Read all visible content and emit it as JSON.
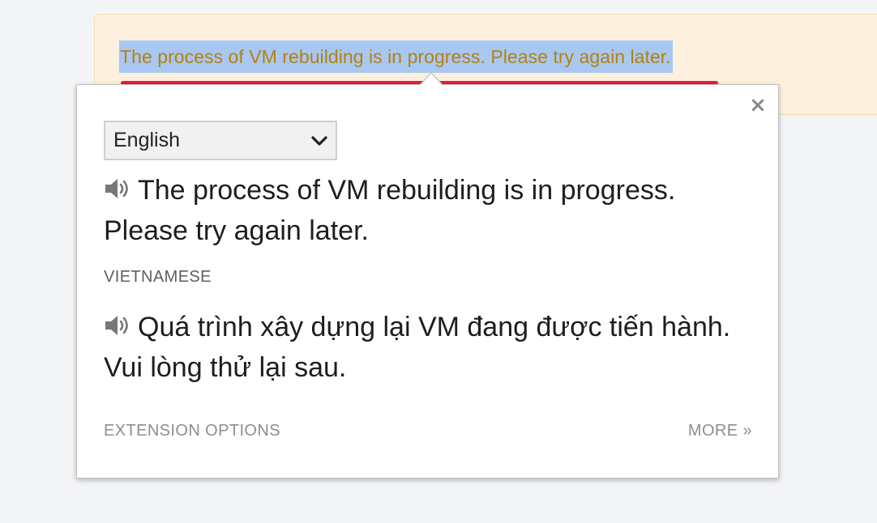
{
  "alert": {
    "message": "The process of VM rebuilding is in progress. Please try again later."
  },
  "popup": {
    "close_glyph": "×",
    "language_select": {
      "selected": "English"
    },
    "source": {
      "text": "The process of VM rebuilding is in progress. Please try again later."
    },
    "target": {
      "language_label": "VIETNAMESE",
      "text": "Quá trình xây dựng lại VM đang được tiến hành. Vui lòng thử lại sau."
    },
    "footer": {
      "extension_options": "EXTENSION OPTIONS",
      "more": "MORE »"
    }
  },
  "icons": {
    "speaker": "speaker-icon",
    "close": "close-icon",
    "dropdown": "chevron-down-icon"
  },
  "colors": {
    "alert_bg": "#fdf0df",
    "alert_text": "#b3810f",
    "selection_highlight": "#a9c8f1",
    "underline": "#f0183c"
  }
}
